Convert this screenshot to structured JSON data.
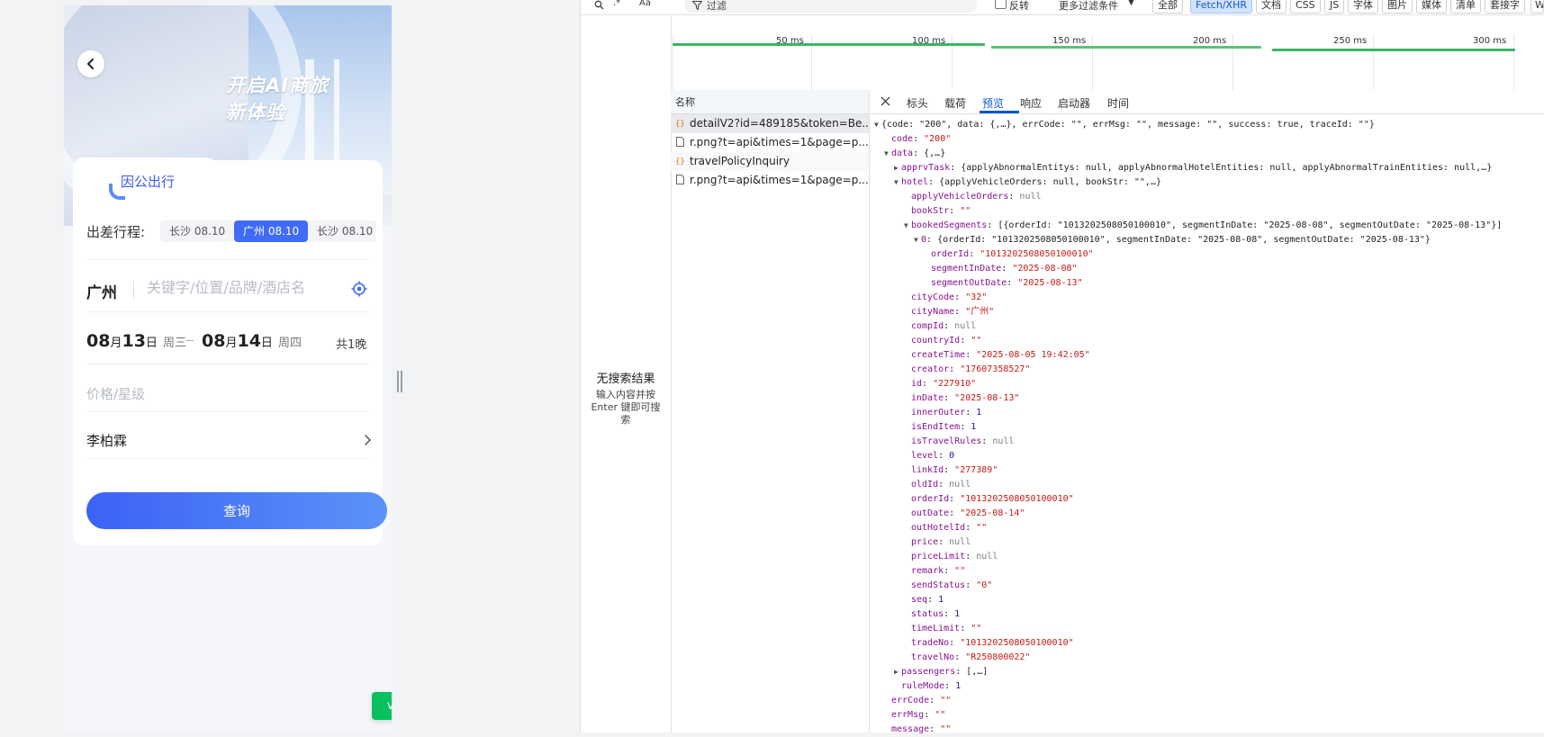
{
  "app": {
    "slogan_line1": "开启AI商旅",
    "slogan_line2": "新体验",
    "tab_label": "因公出行",
    "trip_label": "出差行程:",
    "trip_chips": [
      "长沙 08.10",
      "广州 08.10",
      "长沙 08.10"
    ],
    "city": "广州",
    "search_placeholder": "关键字/位置/品牌/酒店名",
    "checkin": {
      "month": "08",
      "month_unit": "月",
      "day": "13",
      "day_unit": "日",
      "weekday": "周三"
    },
    "checkout": {
      "month": "08",
      "month_unit": "月",
      "day": "14",
      "day_unit": "日",
      "weekday": "周四"
    },
    "nights": "共1晚",
    "price_placeholder": "价格/星级",
    "traveler": "李柏霖",
    "query_button": "查询",
    "vconsole": "vConsole",
    "accent_color": "#3f6bf7"
  },
  "devtools": {
    "toolbar": {
      "regex_label": ".*",
      "case_label": "Aa",
      "filter_placeholder": "过滤",
      "invert_label": "反转",
      "more_filters": "更多过滤条件",
      "types": [
        "全部",
        "Fetch/XHR",
        "文档",
        "CSS",
        "JS",
        "字体",
        "图片",
        "媒体",
        "清单",
        "套接字",
        "W"
      ],
      "active_type": "Fetch/XHR"
    },
    "timeline_ticks": [
      "50 ms",
      "100 ms",
      "150 ms",
      "200 ms",
      "250 ms",
      "300 ms"
    ],
    "no_results_title": "无搜索结果",
    "no_results_hint": "输入内容并按 Enter 键即可搜索",
    "list_header": "名称",
    "requests": [
      {
        "name": "detailV2?id=489185&token=Be...",
        "type": "xhr"
      },
      {
        "name": "r.png?t=api&times=1&page=p...",
        "type": "doc"
      },
      {
        "name": "travelPolicyInquiry",
        "type": "xhr"
      },
      {
        "name": "r.png?t=api&times=1&page=p...",
        "type": "doc"
      }
    ],
    "detail_tabs": [
      "标头",
      "载荷",
      "预览",
      "响应",
      "启动器",
      "时间"
    ],
    "active_detail_tab": "预览",
    "json_lines": [
      {
        "indent": 0,
        "tri": "▼",
        "text": "{code: \"200\", data: {,…}, errCode: \"\", errMsg: \"\", message: \"\", success: true, traceId: \"\"}"
      },
      {
        "indent": 1,
        "key": "code",
        "val": "\"200\"",
        "vt": "s"
      },
      {
        "indent": 1,
        "tri": "▼",
        "key": "data",
        "val": "{,…}",
        "vt": "p"
      },
      {
        "indent": 2,
        "tri": "▶",
        "key": "apprvTask",
        "val": "{applyAbnormalEntitys: null, applyAbnormalHotelEntities: null, applyAbnormalTrainEntities: null,…}",
        "vt": "p"
      },
      {
        "indent": 2,
        "tri": "▼",
        "key": "hotel",
        "val": "{applyVehicleOrders: null, bookStr: \"\",…}",
        "vt": "p"
      },
      {
        "indent": 3,
        "key": "applyVehicleOrders",
        "val": "null",
        "vt": "nl"
      },
      {
        "indent": 3,
        "key": "bookStr",
        "val": "\"\"",
        "vt": "s"
      },
      {
        "indent": 3,
        "tri": "▼",
        "key": "bookedSegments",
        "val": "[{orderId: \"1013202508050100010\", segmentInDate: \"2025-08-08\", segmentOutDate: \"2025-08-13\"}]",
        "vt": "p"
      },
      {
        "indent": 4,
        "tri": "▼",
        "key": "0",
        "val": "{orderId: \"1013202508050100010\", segmentInDate: \"2025-08-08\", segmentOutDate: \"2025-08-13\"}",
        "vt": "p"
      },
      {
        "indent": 5,
        "key": "orderId",
        "val": "\"1013202508050100010\"",
        "vt": "s"
      },
      {
        "indent": 5,
        "key": "segmentInDate",
        "val": "\"2025-08-08\"",
        "vt": "s"
      },
      {
        "indent": 5,
        "key": "segmentOutDate",
        "val": "\"2025-08-13\"",
        "vt": "s"
      },
      {
        "indent": 3,
        "key": "cityCode",
        "val": "\"32\"",
        "vt": "s"
      },
      {
        "indent": 3,
        "key": "cityName",
        "val": "\"广州\"",
        "vt": "s"
      },
      {
        "indent": 3,
        "key": "compId",
        "val": "null",
        "vt": "nl"
      },
      {
        "indent": 3,
        "key": "countryId",
        "val": "\"\"",
        "vt": "s"
      },
      {
        "indent": 3,
        "key": "createTime",
        "val": "\"2025-08-05 19:42:05\"",
        "vt": "s"
      },
      {
        "indent": 3,
        "key": "creator",
        "val": "\"17607358527\"",
        "vt": "s"
      },
      {
        "indent": 3,
        "key": "id",
        "val": "\"227910\"",
        "vt": "s"
      },
      {
        "indent": 3,
        "key": "inDate",
        "val": "\"2025-08-13\"",
        "vt": "s"
      },
      {
        "indent": 3,
        "key": "innerOuter",
        "val": "1",
        "vt": "n"
      },
      {
        "indent": 3,
        "key": "isEndItem",
        "val": "1",
        "vt": "n"
      },
      {
        "indent": 3,
        "key": "isTravelRules",
        "val": "null",
        "vt": "nl"
      },
      {
        "indent": 3,
        "key": "level",
        "val": "0",
        "vt": "n"
      },
      {
        "indent": 3,
        "key": "linkId",
        "val": "\"277389\"",
        "vt": "s"
      },
      {
        "indent": 3,
        "key": "oldId",
        "val": "null",
        "vt": "nl"
      },
      {
        "indent": 3,
        "key": "orderId",
        "val": "\"1013202508050100010\"",
        "vt": "s"
      },
      {
        "indent": 3,
        "key": "outDate",
        "val": "\"2025-08-14\"",
        "vt": "s"
      },
      {
        "indent": 3,
        "key": "outHotelId",
        "val": "\"\"",
        "vt": "s"
      },
      {
        "indent": 3,
        "key": "price",
        "val": "null",
        "vt": "nl"
      },
      {
        "indent": 3,
        "key": "priceLimit",
        "val": "null",
        "vt": "nl"
      },
      {
        "indent": 3,
        "key": "remark",
        "val": "\"\"",
        "vt": "s"
      },
      {
        "indent": 3,
        "key": "sendStatus",
        "val": "\"0\"",
        "vt": "s"
      },
      {
        "indent": 3,
        "key": "seq",
        "val": "1",
        "vt": "n"
      },
      {
        "indent": 3,
        "key": "status",
        "val": "1",
        "vt": "n"
      },
      {
        "indent": 3,
        "key": "timeLimit",
        "val": "\"\"",
        "vt": "s"
      },
      {
        "indent": 3,
        "key": "tradeNo",
        "val": "\"1013202508050100010\"",
        "vt": "s"
      },
      {
        "indent": 3,
        "key": "travelNo",
        "val": "\"R250800022\"",
        "vt": "s"
      },
      {
        "indent": 2,
        "tri": "▶",
        "key": "passengers",
        "val": "[,…]",
        "vt": "p"
      },
      {
        "indent": 2,
        "key": "ruleMode",
        "val": "1",
        "vt": "n"
      },
      {
        "indent": 1,
        "key": "errCode",
        "val": "\"\"",
        "vt": "s"
      },
      {
        "indent": 1,
        "key": "errMsg",
        "val": "\"\"",
        "vt": "s"
      },
      {
        "indent": 1,
        "key": "message",
        "val": "\"\"",
        "vt": "s"
      }
    ]
  }
}
